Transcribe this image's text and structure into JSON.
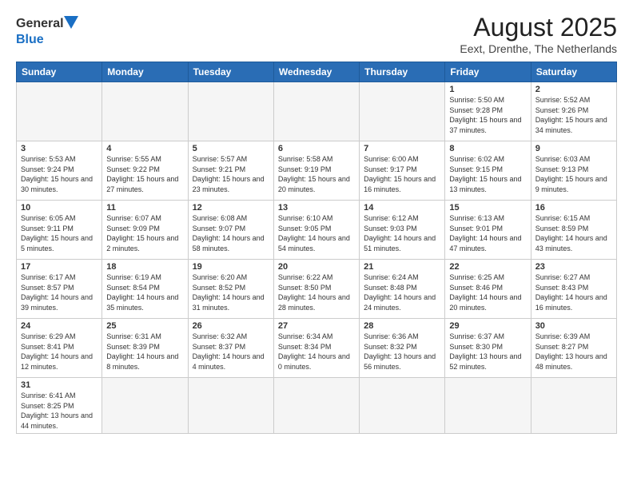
{
  "header": {
    "logo_general": "General",
    "logo_blue": "Blue",
    "main_title": "August 2025",
    "subtitle": "Eext, Drenthe, The Netherlands"
  },
  "days_of_week": [
    "Sunday",
    "Monday",
    "Tuesday",
    "Wednesday",
    "Thursday",
    "Friday",
    "Saturday"
  ],
  "weeks": [
    [
      {
        "day": "",
        "info": ""
      },
      {
        "day": "",
        "info": ""
      },
      {
        "day": "",
        "info": ""
      },
      {
        "day": "",
        "info": ""
      },
      {
        "day": "",
        "info": ""
      },
      {
        "day": "1",
        "info": "Sunrise: 5:50 AM\nSunset: 9:28 PM\nDaylight: 15 hours and 37 minutes."
      },
      {
        "day": "2",
        "info": "Sunrise: 5:52 AM\nSunset: 9:26 PM\nDaylight: 15 hours and 34 minutes."
      }
    ],
    [
      {
        "day": "3",
        "info": "Sunrise: 5:53 AM\nSunset: 9:24 PM\nDaylight: 15 hours and 30 minutes."
      },
      {
        "day": "4",
        "info": "Sunrise: 5:55 AM\nSunset: 9:22 PM\nDaylight: 15 hours and 27 minutes."
      },
      {
        "day": "5",
        "info": "Sunrise: 5:57 AM\nSunset: 9:21 PM\nDaylight: 15 hours and 23 minutes."
      },
      {
        "day": "6",
        "info": "Sunrise: 5:58 AM\nSunset: 9:19 PM\nDaylight: 15 hours and 20 minutes."
      },
      {
        "day": "7",
        "info": "Sunrise: 6:00 AM\nSunset: 9:17 PM\nDaylight: 15 hours and 16 minutes."
      },
      {
        "day": "8",
        "info": "Sunrise: 6:02 AM\nSunset: 9:15 PM\nDaylight: 15 hours and 13 minutes."
      },
      {
        "day": "9",
        "info": "Sunrise: 6:03 AM\nSunset: 9:13 PM\nDaylight: 15 hours and 9 minutes."
      }
    ],
    [
      {
        "day": "10",
        "info": "Sunrise: 6:05 AM\nSunset: 9:11 PM\nDaylight: 15 hours and 5 minutes."
      },
      {
        "day": "11",
        "info": "Sunrise: 6:07 AM\nSunset: 9:09 PM\nDaylight: 15 hours and 2 minutes."
      },
      {
        "day": "12",
        "info": "Sunrise: 6:08 AM\nSunset: 9:07 PM\nDaylight: 14 hours and 58 minutes."
      },
      {
        "day": "13",
        "info": "Sunrise: 6:10 AM\nSunset: 9:05 PM\nDaylight: 14 hours and 54 minutes."
      },
      {
        "day": "14",
        "info": "Sunrise: 6:12 AM\nSunset: 9:03 PM\nDaylight: 14 hours and 51 minutes."
      },
      {
        "day": "15",
        "info": "Sunrise: 6:13 AM\nSunset: 9:01 PM\nDaylight: 14 hours and 47 minutes."
      },
      {
        "day": "16",
        "info": "Sunrise: 6:15 AM\nSunset: 8:59 PM\nDaylight: 14 hours and 43 minutes."
      }
    ],
    [
      {
        "day": "17",
        "info": "Sunrise: 6:17 AM\nSunset: 8:57 PM\nDaylight: 14 hours and 39 minutes."
      },
      {
        "day": "18",
        "info": "Sunrise: 6:19 AM\nSunset: 8:54 PM\nDaylight: 14 hours and 35 minutes."
      },
      {
        "day": "19",
        "info": "Sunrise: 6:20 AM\nSunset: 8:52 PM\nDaylight: 14 hours and 31 minutes."
      },
      {
        "day": "20",
        "info": "Sunrise: 6:22 AM\nSunset: 8:50 PM\nDaylight: 14 hours and 28 minutes."
      },
      {
        "day": "21",
        "info": "Sunrise: 6:24 AM\nSunset: 8:48 PM\nDaylight: 14 hours and 24 minutes."
      },
      {
        "day": "22",
        "info": "Sunrise: 6:25 AM\nSunset: 8:46 PM\nDaylight: 14 hours and 20 minutes."
      },
      {
        "day": "23",
        "info": "Sunrise: 6:27 AM\nSunset: 8:43 PM\nDaylight: 14 hours and 16 minutes."
      }
    ],
    [
      {
        "day": "24",
        "info": "Sunrise: 6:29 AM\nSunset: 8:41 PM\nDaylight: 14 hours and 12 minutes."
      },
      {
        "day": "25",
        "info": "Sunrise: 6:31 AM\nSunset: 8:39 PM\nDaylight: 14 hours and 8 minutes."
      },
      {
        "day": "26",
        "info": "Sunrise: 6:32 AM\nSunset: 8:37 PM\nDaylight: 14 hours and 4 minutes."
      },
      {
        "day": "27",
        "info": "Sunrise: 6:34 AM\nSunset: 8:34 PM\nDaylight: 14 hours and 0 minutes."
      },
      {
        "day": "28",
        "info": "Sunrise: 6:36 AM\nSunset: 8:32 PM\nDaylight: 13 hours and 56 minutes."
      },
      {
        "day": "29",
        "info": "Sunrise: 6:37 AM\nSunset: 8:30 PM\nDaylight: 13 hours and 52 minutes."
      },
      {
        "day": "30",
        "info": "Sunrise: 6:39 AM\nSunset: 8:27 PM\nDaylight: 13 hours and 48 minutes."
      }
    ],
    [
      {
        "day": "31",
        "info": "Sunrise: 6:41 AM\nSunset: 8:25 PM\nDaylight: 13 hours and 44 minutes."
      },
      {
        "day": "",
        "info": ""
      },
      {
        "day": "",
        "info": ""
      },
      {
        "day": "",
        "info": ""
      },
      {
        "day": "",
        "info": ""
      },
      {
        "day": "",
        "info": ""
      },
      {
        "day": "",
        "info": ""
      }
    ]
  ]
}
